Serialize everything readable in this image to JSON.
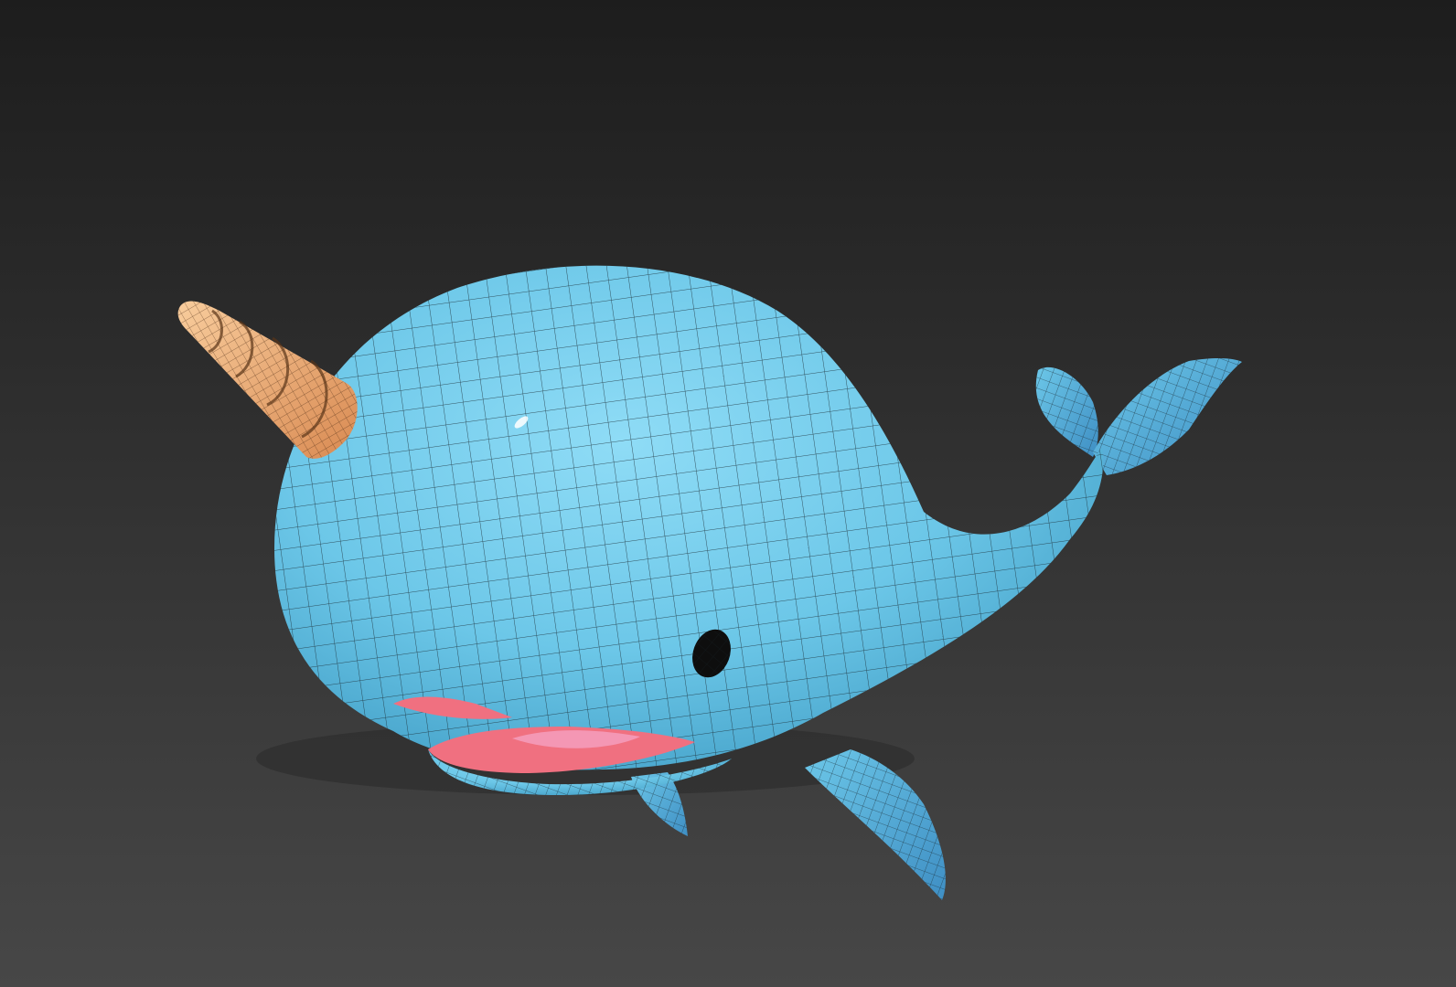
{
  "viewport": {
    "background_top": "#1d1d1d",
    "background_bottom": "#474747"
  },
  "model": {
    "subject": "narwhal",
    "display_mode": "wireframe-on-shaded",
    "colors": {
      "body": "#6cc7e8",
      "body_light": "#8fdcf6",
      "body_dark": "#3f9cc4",
      "fin": "#5aaedf",
      "horn": "#f5b47e",
      "horn_dark": "#d98a52",
      "mouth": "#f07080",
      "tongue": "#f497b4",
      "eye": "#0e0e0e",
      "wire": "#1a2a33"
    }
  }
}
